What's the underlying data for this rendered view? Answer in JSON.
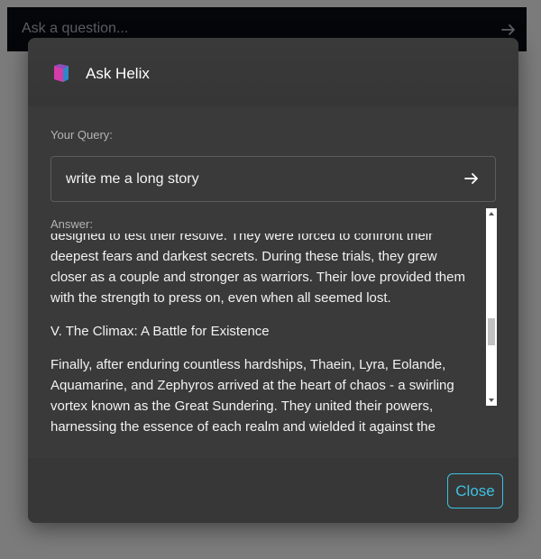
{
  "background": {
    "search_placeholder": "Ask a question..."
  },
  "modal": {
    "title": "Ask Helix",
    "query_label": "Your Query:",
    "query_value": "write me a long story",
    "answer_label": "Answer:",
    "answer_paragraphs": [
      "designed to test their resolve. They were forced to confront their deepest fears and darkest secrets. During these trials, they grew closer as a couple and stronger as warriors. Their love provided them with the strength to press on, even when all seemed lost.",
      "V. The Climax: A Battle for Existence",
      "Finally, after enduring countless hardships, Thaein, Lyra, Eolande, Aquamarine, and Zephyros arrived at the heart of chaos - a swirling vortex known as the Great Sundering. They united their powers, harnessing the essence of each realm and wielded it against the cosmic"
    ],
    "close_label": "Close"
  },
  "colors": {
    "accent": "#3fc1e0",
    "modal_bg": "#373737",
    "backdrop": "#7b7b7b"
  },
  "icons": {
    "logo": "book-icon",
    "submit": "arrow-right-icon"
  }
}
